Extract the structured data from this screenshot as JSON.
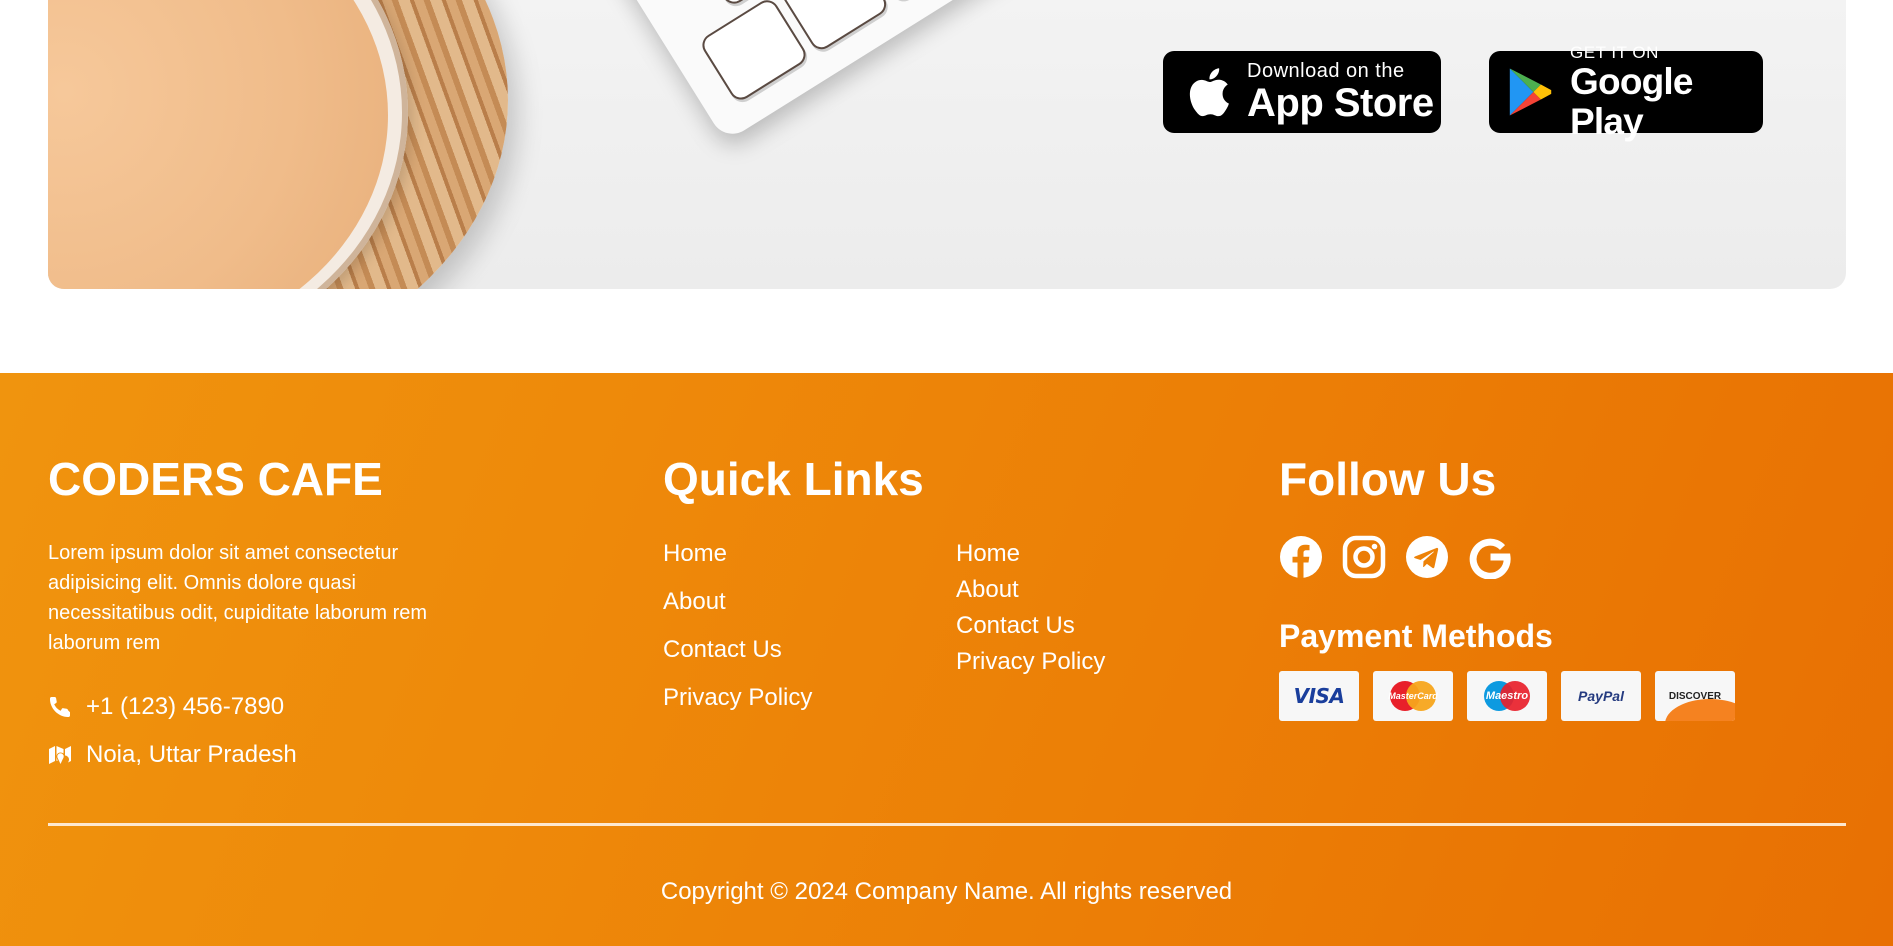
{
  "banner": {
    "app_store": {
      "small": "Download on the",
      "big": "App Store"
    },
    "google_play": {
      "small": "GET IT ON",
      "big": "Google Play"
    }
  },
  "footer": {
    "brand": {
      "title": "CODERS CAFE",
      "description": "Lorem ipsum dolor sit amet consectetur adipisicing elit. Omnis dolore quasi necessitatibus odit, cupiditate laborum rem laborum rem",
      "phone": "+1 (123) 456-7890",
      "address": "Noia, Uttar Pradesh"
    },
    "quick_links": {
      "title": "Quick Links",
      "column1": [
        "Home",
        "About",
        "Contact Us",
        "Privacy Policy"
      ],
      "column2": [
        "Home",
        "About",
        "Contact Us",
        "Privacy Policy"
      ]
    },
    "follow": {
      "title": "Follow Us",
      "icons": [
        "facebook-icon",
        "instagram-icon",
        "telegram-icon",
        "google-icon"
      ]
    },
    "payment": {
      "title": "Payment Methods",
      "cards": [
        "VISA",
        "MasterCard",
        "Maestro",
        "PayPal",
        "DISCOVER"
      ]
    },
    "copyright": "Copyright © 2024 Company Name. All rights reserved"
  },
  "colors": {
    "footer_start": "#f0940e",
    "footer_end": "#e87003",
    "text": "#ffffff"
  }
}
